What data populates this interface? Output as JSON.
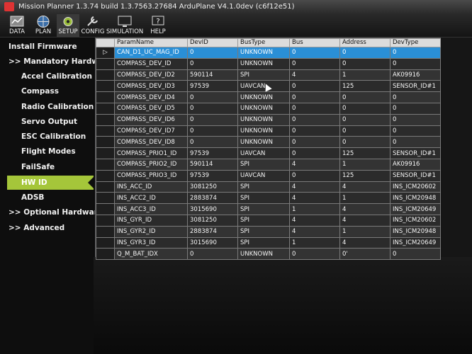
{
  "window": {
    "title": "Mission Planner 1.3.74 build 1.3.7563.27684 ArduPlane V4.1.0dev (c6f12e51)"
  },
  "toolbar": [
    {
      "label": "DATA",
      "icon": "data-icon"
    },
    {
      "label": "PLAN",
      "icon": "globe-icon"
    },
    {
      "label": "SETUP",
      "icon": "gear-icon"
    },
    {
      "label": "CONFIG",
      "icon": "wrench-icon"
    },
    {
      "label": "SIMULATION",
      "icon": "monitor-icon"
    },
    {
      "label": "HELP",
      "icon": "help-icon"
    }
  ],
  "sidebar": [
    {
      "label": "Install Firmware",
      "level": 0
    },
    {
      "label": ">> Mandatory Hardware",
      "level": 0
    },
    {
      "label": "Accel Calibration",
      "level": 1
    },
    {
      "label": "Compass",
      "level": 1
    },
    {
      "label": "Radio Calibration",
      "level": 1
    },
    {
      "label": "Servo Output",
      "level": 1
    },
    {
      "label": "ESC Calibration",
      "level": 1
    },
    {
      "label": "Flight Modes",
      "level": 1
    },
    {
      "label": "FailSafe",
      "level": 1
    },
    {
      "label": "HW ID",
      "level": 1,
      "active": true
    },
    {
      "label": "ADSB",
      "level": 1
    },
    {
      "label": ">> Optional Hardware",
      "level": 0
    },
    {
      "label": ">> Advanced",
      "level": 0
    }
  ],
  "grid": {
    "columns": [
      "ParamName",
      "DevID",
      "BusType",
      "Bus",
      "Address",
      "DevType"
    ],
    "rows": [
      [
        "CAN_D1_UC_MAG_ID",
        "0",
        "UNKNOWN",
        "0",
        "0",
        "0"
      ],
      [
        "COMPASS_DEV_ID",
        "0",
        "UNKNOWN",
        "0",
        "0",
        "0"
      ],
      [
        "COMPASS_DEV_ID2",
        "590114",
        "SPI",
        "4",
        "1",
        "AK09916"
      ],
      [
        "COMPASS_DEV_ID3",
        "97539",
        "UAVCAN",
        "0",
        "125",
        "SENSOR_ID#1"
      ],
      [
        "COMPASS_DEV_ID4",
        "0",
        "UNKNOWN",
        "0",
        "0",
        "0"
      ],
      [
        "COMPASS_DEV_ID5",
        "0",
        "UNKNOWN",
        "0",
        "0",
        "0"
      ],
      [
        "COMPASS_DEV_ID6",
        "0",
        "UNKNOWN",
        "0",
        "0",
        "0"
      ],
      [
        "COMPASS_DEV_ID7",
        "0",
        "UNKNOWN",
        "0",
        "0",
        "0"
      ],
      [
        "COMPASS_DEV_ID8",
        "0",
        "UNKNOWN",
        "0",
        "0",
        "0"
      ],
      [
        "COMPASS_PRIO1_ID",
        "97539",
        "UAVCAN",
        "0",
        "125",
        "SENSOR_ID#1"
      ],
      [
        "COMPASS_PRIO2_ID",
        "590114",
        "SPI",
        "4",
        "1",
        "AK09916"
      ],
      [
        "COMPASS_PRIO3_ID",
        "97539",
        "UAVCAN",
        "0",
        "125",
        "SENSOR_ID#1"
      ],
      [
        "INS_ACC_ID",
        "3081250",
        "SPI",
        "4",
        "4",
        "INS_ICM20602"
      ],
      [
        "INS_ACC2_ID",
        "2883874",
        "SPI",
        "4",
        "1",
        "INS_ICM20948"
      ],
      [
        "INS_ACC3_ID",
        "3015690",
        "SPI",
        "1",
        "4",
        "INS_ICM20649"
      ],
      [
        "INS_GYR_ID",
        "3081250",
        "SPI",
        "4",
        "4",
        "INS_ICM20602"
      ],
      [
        "INS_GYR2_ID",
        "2883874",
        "SPI",
        "4",
        "1",
        "INS_ICM20948"
      ],
      [
        "INS_GYR3_ID",
        "3015690",
        "SPI",
        "1",
        "4",
        "INS_ICM20649"
      ],
      [
        "Q_M_BAT_IDX",
        "0",
        "UNKNOWN",
        "0",
        "0'",
        "0"
      ]
    ],
    "selected_row": 0
  },
  "colors": {
    "accent": "#a5c63a",
    "selection": "#2a8fd6"
  }
}
